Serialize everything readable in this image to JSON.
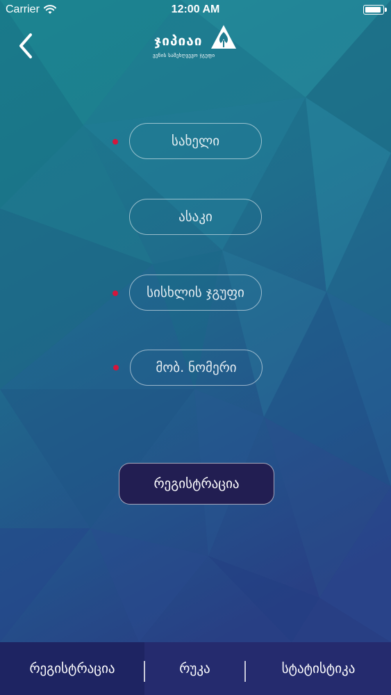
{
  "status_bar": {
    "carrier": "Carrier",
    "time": "12:00 AM",
    "icons": [
      "wifi-icon",
      "battery-icon"
    ]
  },
  "header": {
    "back_icon": "chevron-left-icon",
    "logo": {
      "title": "ჯიპიაი",
      "subtitle": "ვენის სამეხღვევო ჯგუფი",
      "mark_icon": "tree-triangle-icon"
    }
  },
  "form": {
    "required_marker_color": "#d4163c",
    "fields": [
      {
        "placeholder": "სახელი",
        "value": "",
        "required": true
      },
      {
        "placeholder": "ასაკი",
        "value": "",
        "required": false
      },
      {
        "placeholder": "სისხლის ჯგუფი",
        "value": "",
        "required": true
      },
      {
        "placeholder": "მობ. ნომერი",
        "value": "",
        "required": true
      }
    ],
    "submit_label": "რეგისტრაცია",
    "submit_color": "#221e52"
  },
  "tabbar": {
    "background": "#252b6e",
    "active_tab": 0,
    "tabs": [
      {
        "label": "რეგისტრაცია"
      },
      {
        "label": "რუკა"
      },
      {
        "label": "სტატისტიკა"
      }
    ]
  }
}
